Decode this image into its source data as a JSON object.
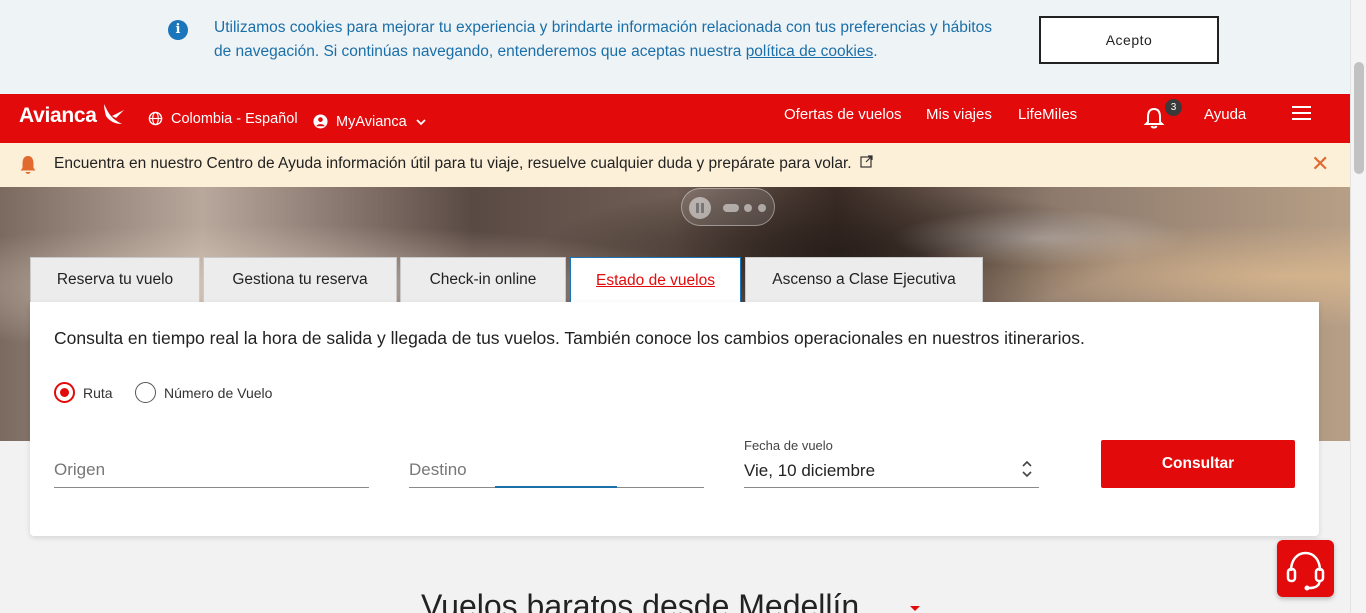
{
  "cookie_banner": {
    "text_before_link": "Utilizamos cookies para mejorar tu experiencia y brindarte información relacionada con tus preferencias y hábitos de navegación. Si continúas navegando, entenderemos que aceptas nuestra ",
    "link_text": "política de cookies",
    "text_after_link": ".",
    "accept_label": "Acepto"
  },
  "header": {
    "logo_text": "Avianca",
    "locale": "Colombia - Español",
    "account": "MyAvianca",
    "nav": [
      "Ofertas de vuelos",
      "Mis viajes",
      "LifeMiles"
    ],
    "notification_count": "3",
    "help": "Ayuda"
  },
  "help_strip": {
    "message": "Encuentra en nuestro Centro de Ayuda información útil para tu viaje, resuelve cualquier duda y prepárate para volar."
  },
  "tabs": [
    "Reserva tu vuelo",
    "Gestiona tu reserva",
    "Check-in online",
    "Estado de vuelos",
    "Ascenso a Clase Ejecutiva"
  ],
  "active_tab": "Estado de vuelos",
  "flight_status": {
    "description": "Consulta en tiempo real la hora de salida y llegada de tus vuelos. También conoce los cambios operacionales en nuestros itinerarios.",
    "radio_route": "Ruta",
    "radio_flight_number": "Número de Vuelo",
    "origin_placeholder": "Origen",
    "destination_placeholder": "Destino",
    "date_label": "Fecha de vuelo",
    "date_value": "Vie, 10 diciembre",
    "submit_label": "Consultar"
  },
  "section_title": "Vuelos baratos desde Medellín",
  "colors": {
    "brand_red": "#e20a0a",
    "info_blue": "#1b75bb",
    "help_bg": "#fdf0d9"
  }
}
